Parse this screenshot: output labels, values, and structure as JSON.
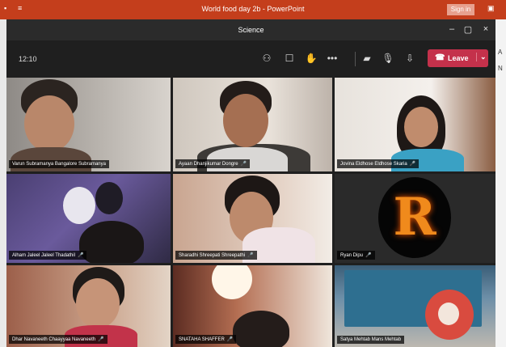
{
  "powerpoint": {
    "title": "World food day 2b - PowerPoint",
    "sign_in": "Sign in",
    "right_labels": [
      "A",
      "N"
    ]
  },
  "meeting": {
    "window_title": "Science",
    "timer": "12:10",
    "leave_label": "Leave",
    "icons": [
      "people-icon",
      "chat-icon",
      "raise-hand-icon",
      "more-icon",
      "camera-off-icon",
      "mic-icon",
      "share-tray-icon"
    ]
  },
  "participants": [
    {
      "name": "Varun Subramanya Bangalore Subramanya",
      "muted": false
    },
    {
      "name": "Ayaan Dhanjikumar Dongre",
      "muted": true
    },
    {
      "name": "Jovina Eldhose Eldhose Skaria",
      "muted": true
    },
    {
      "name": "Alham Jaleel Jaleel Thadathil",
      "muted": true
    },
    {
      "name": "Sharadhi Shreepati Shreepathi",
      "muted": true
    },
    {
      "name": "Ryan Dipu",
      "muted": true
    },
    {
      "name": "Dhar Navaneeth Chaayyaa Navaneeth",
      "muted": true
    },
    {
      "name": "SNATAHA SHAFFER",
      "muted": true
    },
    {
      "name": "Satya Mehtab Mans Mehtab",
      "muted": false
    }
  ],
  "avatar_letter": "R",
  "colors": {
    "ppt_red": "#c43e1c",
    "leave_red": "#c4314b",
    "teams_bg": "#1f1f1f"
  }
}
